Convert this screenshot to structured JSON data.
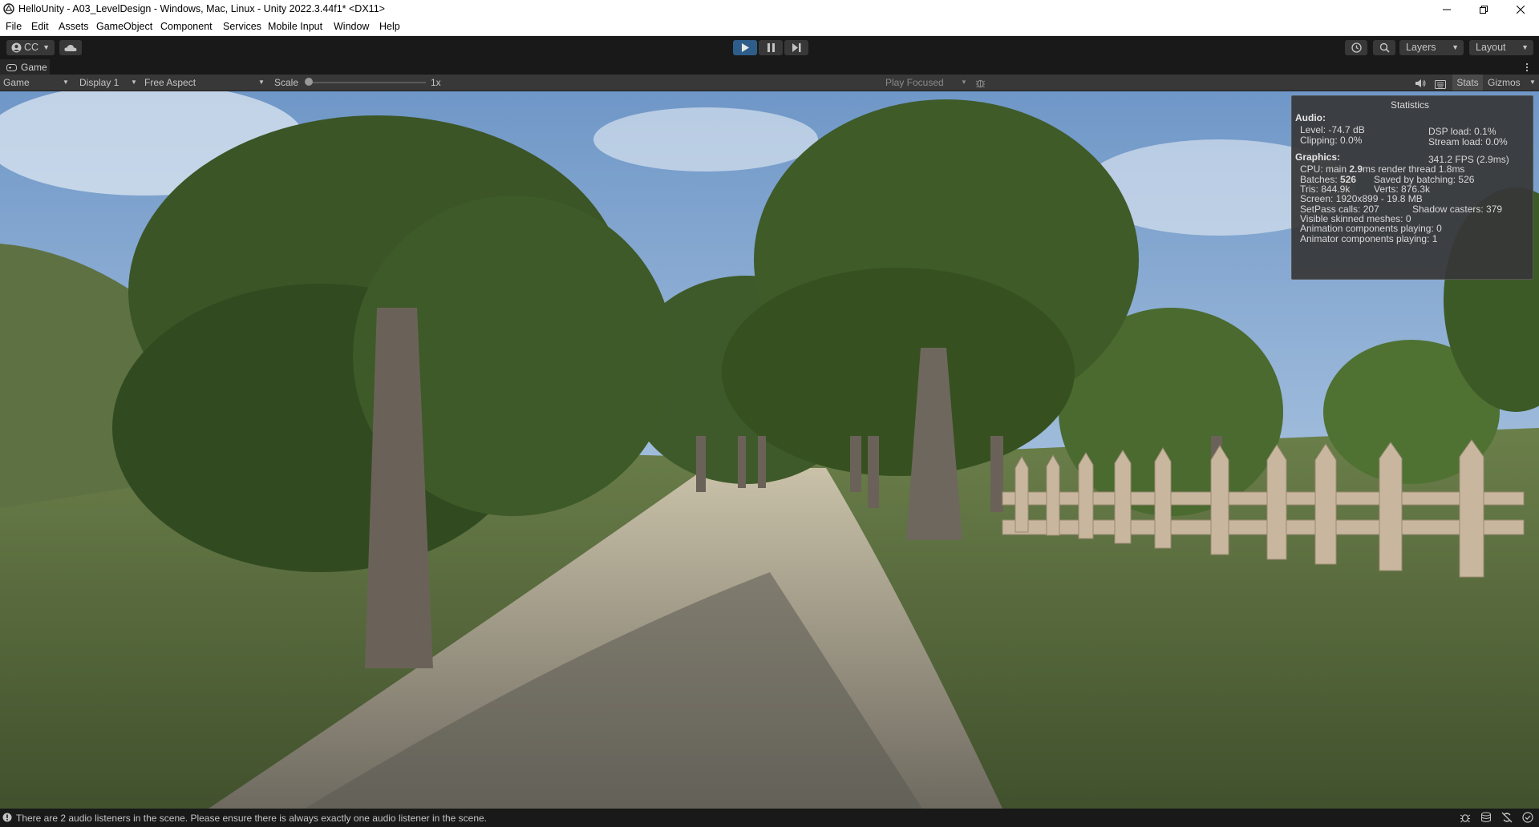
{
  "window": {
    "title": "HelloUnity - A03_LevelDesign - Windows, Mac, Linux - Unity 2022.3.44f1* <DX11>"
  },
  "menu": [
    "File",
    "Edit",
    "Assets",
    "GameObject",
    "Component",
    "Services",
    "Mobile Input",
    "Window",
    "Help"
  ],
  "toolbar": {
    "account_label": "CC",
    "layers_label": "Layers",
    "layout_label": "Layout"
  },
  "game_tab": {
    "label": "Game"
  },
  "game_toolbar": {
    "view_select": "Game",
    "display_select": "Display 1",
    "aspect_select": "Free Aspect",
    "scale_label": "Scale",
    "scale_value": "1x",
    "play_mode": "Play Focused",
    "stats_label": "Stats",
    "gizmos_label": "Gizmos"
  },
  "stats": {
    "title": "Statistics",
    "audio_header": "Audio:",
    "level": "Level: -74.7 dB",
    "clipping": "Clipping: 0.0%",
    "dsp_load": "DSP load: 0.1%",
    "stream_load": "Stream load: 0.0%",
    "graphics_header": "Graphics:",
    "fps": "341.2 FPS (2.9ms)",
    "cpu_prefix": "CPU: main ",
    "cpu_main": "2.9",
    "cpu_suffix": "ms  render thread 1.8ms",
    "batches_prefix": "Batches: ",
    "batches": "526",
    "saved_batching": "Saved by batching: 526",
    "tris": "Tris: 844.9k",
    "verts": "Verts: 876.3k",
    "screen": "Screen: 1920x899 - 19.8 MB",
    "setpass": "SetPass calls: 207",
    "shadow_casters": "Shadow casters: 379",
    "skinned": "Visible skinned meshes: 0",
    "animation": "Animation components playing: 0",
    "animator": "Animator components playing: 1"
  },
  "status": {
    "message": "There are 2 audio listeners in the scene. Please ensure there is always exactly one audio listener in the scene."
  }
}
